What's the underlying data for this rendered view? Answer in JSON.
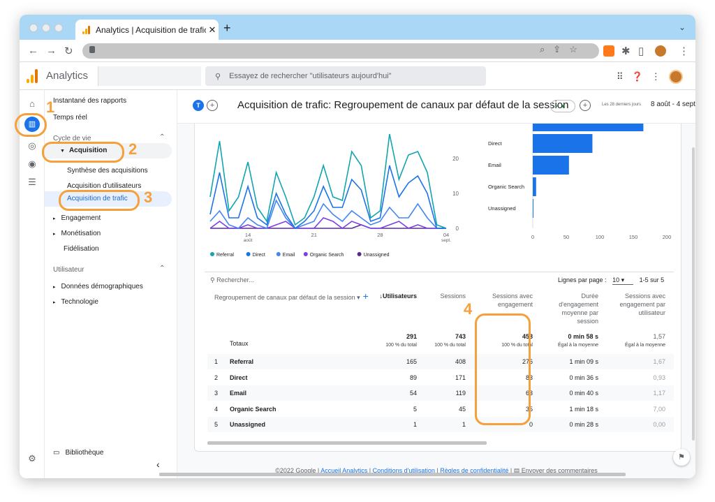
{
  "browser": {
    "tab_title": "Analytics | Acquisition de trafic",
    "tab_close": "✕",
    "new_tab": "+"
  },
  "app": {
    "name": "Analytics",
    "search_placeholder": "Essayez de rechercher \"utilisateurs aujourd'hui\""
  },
  "sidebar": {
    "items": [
      {
        "label": "Instantané des rapports"
      },
      {
        "label": "Temps réel"
      },
      {
        "label": "Cycle de vie"
      },
      {
        "label": "Acquisition"
      },
      {
        "label": "Synthèse des acquisitions"
      },
      {
        "label": "Acquisition d'utilisateurs"
      },
      {
        "label": "Acquisition de trafic"
      },
      {
        "label": "Engagement"
      },
      {
        "label": "Monétisation"
      },
      {
        "label": "Fidélisation"
      },
      {
        "label": "Utilisateur"
      },
      {
        "label": "Données démographiques"
      },
      {
        "label": "Technologie"
      },
      {
        "label": "Bibliothèque"
      }
    ]
  },
  "header": {
    "title": "Acquisition de trafic: Regroupement de canaux par défaut de la session",
    "date_range_label": "Les 28 derniers jours",
    "dates": "8 août - 4 sept. 2022",
    "tag": "T"
  },
  "chart_data": [
    {
      "type": "line",
      "x": [
        "10 août",
        "11",
        "12",
        "13",
        "14",
        "15",
        "16",
        "17",
        "18",
        "19",
        "20",
        "21",
        "22",
        "23",
        "24",
        "25",
        "26",
        "27",
        "28",
        "29",
        "30",
        "31",
        "01 sept.",
        "02",
        "03",
        "04"
      ],
      "x_tick_labels": [
        "14\naoût",
        "21",
        "28",
        "04\nsept."
      ],
      "series": [
        {
          "name": "Referral",
          "color": "#12a4af",
          "values": [
            9,
            25,
            5,
            9,
            19,
            6,
            2,
            16,
            9,
            1,
            3,
            9,
            18,
            9,
            8,
            22,
            18,
            3,
            5,
            27,
            14,
            21,
            22,
            16,
            1,
            0
          ]
        },
        {
          "name": "Direct",
          "color": "#1a73e8",
          "values": [
            4,
            16,
            3,
            3,
            12,
            3,
            1,
            10,
            4,
            0,
            2,
            5,
            12,
            6,
            6,
            14,
            11,
            2,
            3,
            18,
            9,
            13,
            15,
            10,
            0,
            0
          ]
        },
        {
          "name": "Email",
          "color": "#4285f4",
          "values": [
            2,
            5,
            1,
            0,
            3,
            1,
            0,
            8,
            3,
            0,
            1,
            2,
            7,
            4,
            2,
            5,
            3,
            1,
            2,
            6,
            3,
            3,
            7,
            3,
            0,
            0
          ]
        },
        {
          "name": "Organic Search",
          "color": "#7b3fe4",
          "values": [
            0,
            2,
            0,
            0,
            1,
            0,
            0,
            1,
            2,
            0,
            0,
            0,
            3,
            2,
            0,
            2,
            1,
            0,
            0,
            1,
            2,
            0,
            1,
            0,
            0,
            0
          ]
        },
        {
          "name": "Unassigned",
          "color": "#5b2b8c",
          "values": [
            0,
            0,
            0,
            0,
            0,
            0,
            0,
            0,
            0,
            0,
            0,
            0,
            0,
            0,
            0,
            0,
            1,
            0,
            0,
            0,
            0,
            0,
            0,
            0,
            0,
            0
          ]
        }
      ],
      "y_ticks": [
        0,
        10,
        20
      ],
      "ylim": [
        0,
        30
      ]
    },
    {
      "type": "bar",
      "orientation": "horizontal",
      "categories": [
        "Referral",
        "Direct",
        "Email",
        "Organic Search",
        "Unassigned"
      ],
      "values": [
        165,
        89,
        54,
        5,
        1
      ],
      "x_ticks": [
        0,
        50,
        100,
        150,
        200
      ],
      "xlim": [
        0,
        200
      ],
      "color": "#1a73e8"
    }
  ],
  "table": {
    "search_placeholder": "Rechercher...",
    "rows_per_page_label": "Lignes par page :",
    "rows_per_page": "10",
    "range": "1-5 sur 5",
    "dim_header": "Regroupement de canaux par défaut de la session",
    "headers": [
      "↓Utilisateurs",
      "Sessions",
      "Sessions avec engagement",
      "Durée d'engagement moyenne par session",
      "Sessions avec engagement par utilisateur"
    ],
    "totals_label": "Totaux",
    "totals": [
      {
        "value": "291",
        "sub": "100 % du total"
      },
      {
        "value": "743",
        "sub": "100 % du total"
      },
      {
        "value": "458",
        "sub": "100 % du total"
      },
      {
        "value": "0 min 58 s",
        "sub": "Égal à la moyenne"
      },
      {
        "value": "1,57",
        "sub": "Égal à la moyenne"
      }
    ],
    "rows": [
      {
        "n": "1",
        "name": "Referral",
        "c1": "165",
        "c2": "408",
        "c3": "276",
        "c4": "1 min 09 s",
        "c5": "1,67"
      },
      {
        "n": "2",
        "name": "Direct",
        "c1": "89",
        "c2": "171",
        "c3": "83",
        "c4": "0 min 36 s",
        "c5": "0,93"
      },
      {
        "n": "3",
        "name": "Email",
        "c1": "54",
        "c2": "119",
        "c3": "63",
        "c4": "0 min 40 s",
        "c5": "1,17"
      },
      {
        "n": "4",
        "name": "Organic Search",
        "c1": "5",
        "c2": "45",
        "c3": "35",
        "c4": "1 min 18 s",
        "c5": "7,00"
      },
      {
        "n": "5",
        "name": "Unassigned",
        "c1": "1",
        "c2": "1",
        "c3": "0",
        "c4": "0 min 28 s",
        "c5": "0,00"
      }
    ]
  },
  "footer": {
    "copyright": "©2022 Google |",
    "links": [
      "Accueil Analytics",
      "Conditions d'utilisation",
      "Règles de confidentialité"
    ],
    "sep": "|",
    "feedback": "Envoyer des commentaires"
  },
  "annotations": [
    "1",
    "2",
    "3",
    "4"
  ],
  "colors": {
    "accent": "#1a73e8",
    "annotation": "#f5a03a",
    "tabbar": "#a9d7f5"
  },
  "icons": [
    "home-icon",
    "reports-icon",
    "explore-icon",
    "advertising-icon",
    "configure-icon",
    "settings-icon",
    "search-icon",
    "apps-icon",
    "help-icon",
    "more-icon"
  ]
}
